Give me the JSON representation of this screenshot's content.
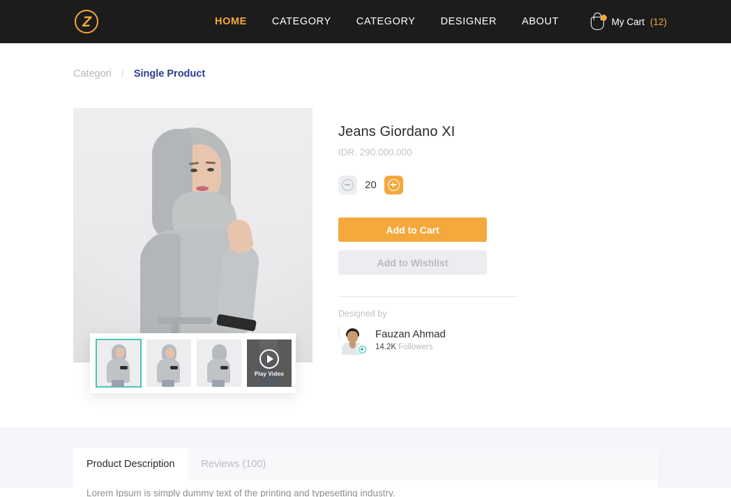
{
  "header": {
    "logo_name": "z-lightning-logo",
    "nav": [
      {
        "label": "HOME",
        "active": true
      },
      {
        "label": "CATEGORY",
        "active": false
      },
      {
        "label": "CATEGORY",
        "active": false
      },
      {
        "label": "DESIGNER",
        "active": false
      },
      {
        "label": "ABOUT",
        "active": false
      }
    ],
    "cart": {
      "label": "My Cart",
      "count": "(12)",
      "icon": "shopping-bag-icon"
    },
    "background": "#1c1c1c",
    "accent": "#f4a93c"
  },
  "breadcrumb": {
    "parent": "Categori",
    "separator": "/",
    "current": "Single Product",
    "current_color": "#2b3a8f"
  },
  "gallery": {
    "main_image_alt": "Model wearing grey hijab and grey long dress",
    "thumbnails": [
      {
        "alt": "Front view",
        "selected": true
      },
      {
        "alt": "Side view",
        "selected": false
      },
      {
        "alt": "Back view",
        "selected": false
      }
    ],
    "video_thumb": {
      "label": "Play Video",
      "icon": "play-circle-icon"
    },
    "selected_border_color": "#49c5b6"
  },
  "product": {
    "title": "Jeans Giordano XI",
    "price": "IDR. 290.000.000",
    "quantity": "20",
    "decrease_icon": "minus-circle-icon",
    "increase_icon": "plus-circle-icon",
    "add_to_cart_label": "Add to Cart",
    "add_to_wishlist_label": "Add to Wishlist",
    "cart_button_color": "#f4a93c",
    "wishlist_button_color": "#ecedf1"
  },
  "designer": {
    "label": "Designed by",
    "name": "Fauzan Ahmad",
    "followers_count": "14.2K",
    "followers_label": "Followers",
    "verified_icon": "verified-badge-icon",
    "verified_color": "#2ec4b0"
  },
  "tabs": [
    {
      "label": "Product Description",
      "active": true
    },
    {
      "label": "Reviews (100)",
      "active": false
    }
  ],
  "tab_panel": {
    "text": "Lorem Ipsum is simply dummy text of the printing and typesetting industry."
  }
}
